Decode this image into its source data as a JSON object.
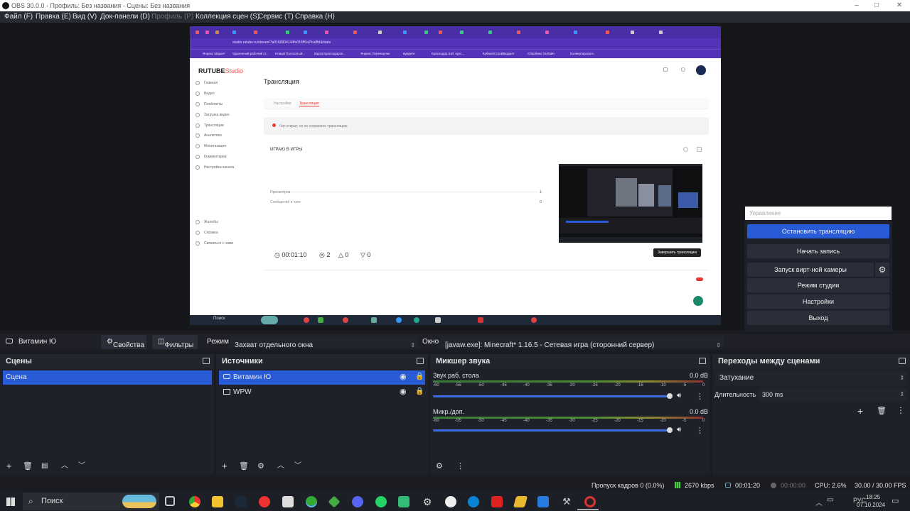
{
  "window": {
    "title": "OBS 30.0.0 - Профиль: Без названия - Сцены: Без названия"
  },
  "menu": {
    "items": [
      "Файл (F)",
      "Правка (E)",
      "Вид (V)",
      "Док-панели (D)",
      "Профиль (P)",
      "Коллекция сцен (S)",
      "Сервис (T)",
      "Справка (H)"
    ]
  },
  "captured": {
    "url": "studio.rutube.ru/stream/7a0168904144fa016ff0a2fca8fd4/stats",
    "bookmarks": [
      "Яндекс Маркет",
      "Удаленный рабочий ст...",
      "Новый Полосатый...",
      "Карта Краснодарск...",
      "Яндекс Переводчик",
      "вурдите",
      "Краснодар ШИ: курс...",
      "КубанИСтройБюджет",
      "Сбербанк ОнЛайн",
      "Конвертировать"
    ],
    "logo_main": "RUTUBE",
    "logo_suffix": "Studio",
    "side_items": [
      "Главная",
      "Видео",
      "Плейлисты",
      "Загрузка видео",
      "Трансляции",
      "Аналитика",
      "Монетизация",
      "Комментарии",
      "Настройка канала"
    ],
    "side_items2": [
      "Жалобы",
      "Справка",
      "Связаться с нами"
    ],
    "heading": "Трансляция",
    "tabs": [
      "Настройки",
      "Трансляция"
    ],
    "alert": "Чат открыт, но не сохранено трансляцию",
    "stream_title": "ИГРАЮ В ИГРЫ",
    "row1_label": "Просмотров",
    "row1_val": "1",
    "row2_label": "Сообщений в чате",
    "row2_val": "0",
    "timer": "00:01:10",
    "viewers": "2",
    "likes": "0",
    "dislikes": "0",
    "end_button": "Завершить трансляцию",
    "taskbar_search": "Поиск"
  },
  "scene_toolbar": {
    "source_name": "Витамин Ю",
    "properties": "Свойства",
    "filters": "Фильтры",
    "mode_label": "Режим",
    "mode_value": "Захват отдельного окна",
    "window_label": "Окно",
    "window_value": "[javaw.exe]: Minecraft* 1.16.5 - Сетевая игра (сторонний сервер)"
  },
  "scenes": {
    "title": "Сцены",
    "items": [
      "Сцена"
    ]
  },
  "sources": {
    "title": "Источники",
    "items": [
      "Витамин Ю",
      "WPW"
    ]
  },
  "mixer": {
    "title": "Микшер звука",
    "channels": [
      {
        "name": "Звук раб. стола",
        "db": "0.0 dB"
      },
      {
        "name": "Микр./доп.",
        "db": "0.0 dB"
      }
    ],
    "ticks": [
      "-60",
      "-55",
      "-50",
      "-45",
      "-40",
      "-35",
      "-30",
      "-25",
      "-20",
      "-15",
      "-10",
      "-5",
      "0"
    ]
  },
  "transitions": {
    "title": "Переходы между сценами",
    "type": "Затухание",
    "duration_label": "Длительность",
    "duration": "300 ms"
  },
  "controls": {
    "title": "Управление",
    "stop_stream": "Остановить трансляцию",
    "start_record": "Начать запись",
    "virtual_cam": "Запуск вирт-ной камеры",
    "studio_mode": "Режим студии",
    "settings": "Настройки",
    "exit": "Выход"
  },
  "status": {
    "dropped": "Пропуск кадров 0 (0.0%)",
    "bitrate": "2670 kbps",
    "stream_time": "00:01:20",
    "rec_time": "00:00:00",
    "cpu": "CPU: 2.6%",
    "fps": "30.00 / 30.00 FPS"
  },
  "taskbar": {
    "search": "Поиск",
    "lang": "РУС",
    "time": "18:25",
    "date": "07.10.2024"
  },
  "colors": {
    "accent": "#2a5bd7",
    "panel": "#1f212a",
    "rutube_purple": "#5533b8"
  }
}
